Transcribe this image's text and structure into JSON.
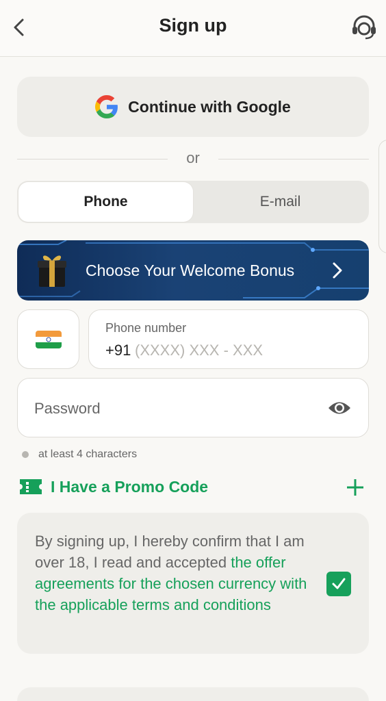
{
  "header": {
    "title": "Sign up",
    "back_icon": "chevron-left-icon",
    "support_icon": "headset-support-icon"
  },
  "google": {
    "label": "Continue with Google",
    "icon": "google-g-icon",
    "colors": {
      "blue": "#4285F4",
      "red": "#EA4335",
      "yellow": "#FBBC05",
      "green": "#34A853"
    }
  },
  "divider": {
    "text": "or"
  },
  "tabs": [
    {
      "label": "Phone",
      "active": true
    },
    {
      "label": "E-mail",
      "active": false
    }
  ],
  "bonus": {
    "label": "Choose Your Welcome Bonus",
    "icon": "gift-box-icon",
    "chevron_icon": "chevron-right-icon"
  },
  "phone": {
    "country_flag": "india-flag-icon",
    "label": "Phone number",
    "prefix": "+91",
    "placeholder": "(XXXX) XXX - XXX"
  },
  "password": {
    "placeholder": "Password",
    "eye_icon": "eye-icon"
  },
  "hint": {
    "text": "at least 4 characters"
  },
  "promo": {
    "label": "I Have a Promo Code",
    "icon": "ticket-icon",
    "plus_icon": "plus-icon"
  },
  "consent": {
    "text_plain": "By signing up, I hereby confirm that I am over 18, I read and accepted ",
    "text_link": "the offer agreements for the chosen currency with the applicable terms and conditions",
    "checked": true
  },
  "colors": {
    "accent_green": "#16a05a",
    "bonus_bg": "#16406f",
    "page_bg": "#f9f8f5"
  }
}
